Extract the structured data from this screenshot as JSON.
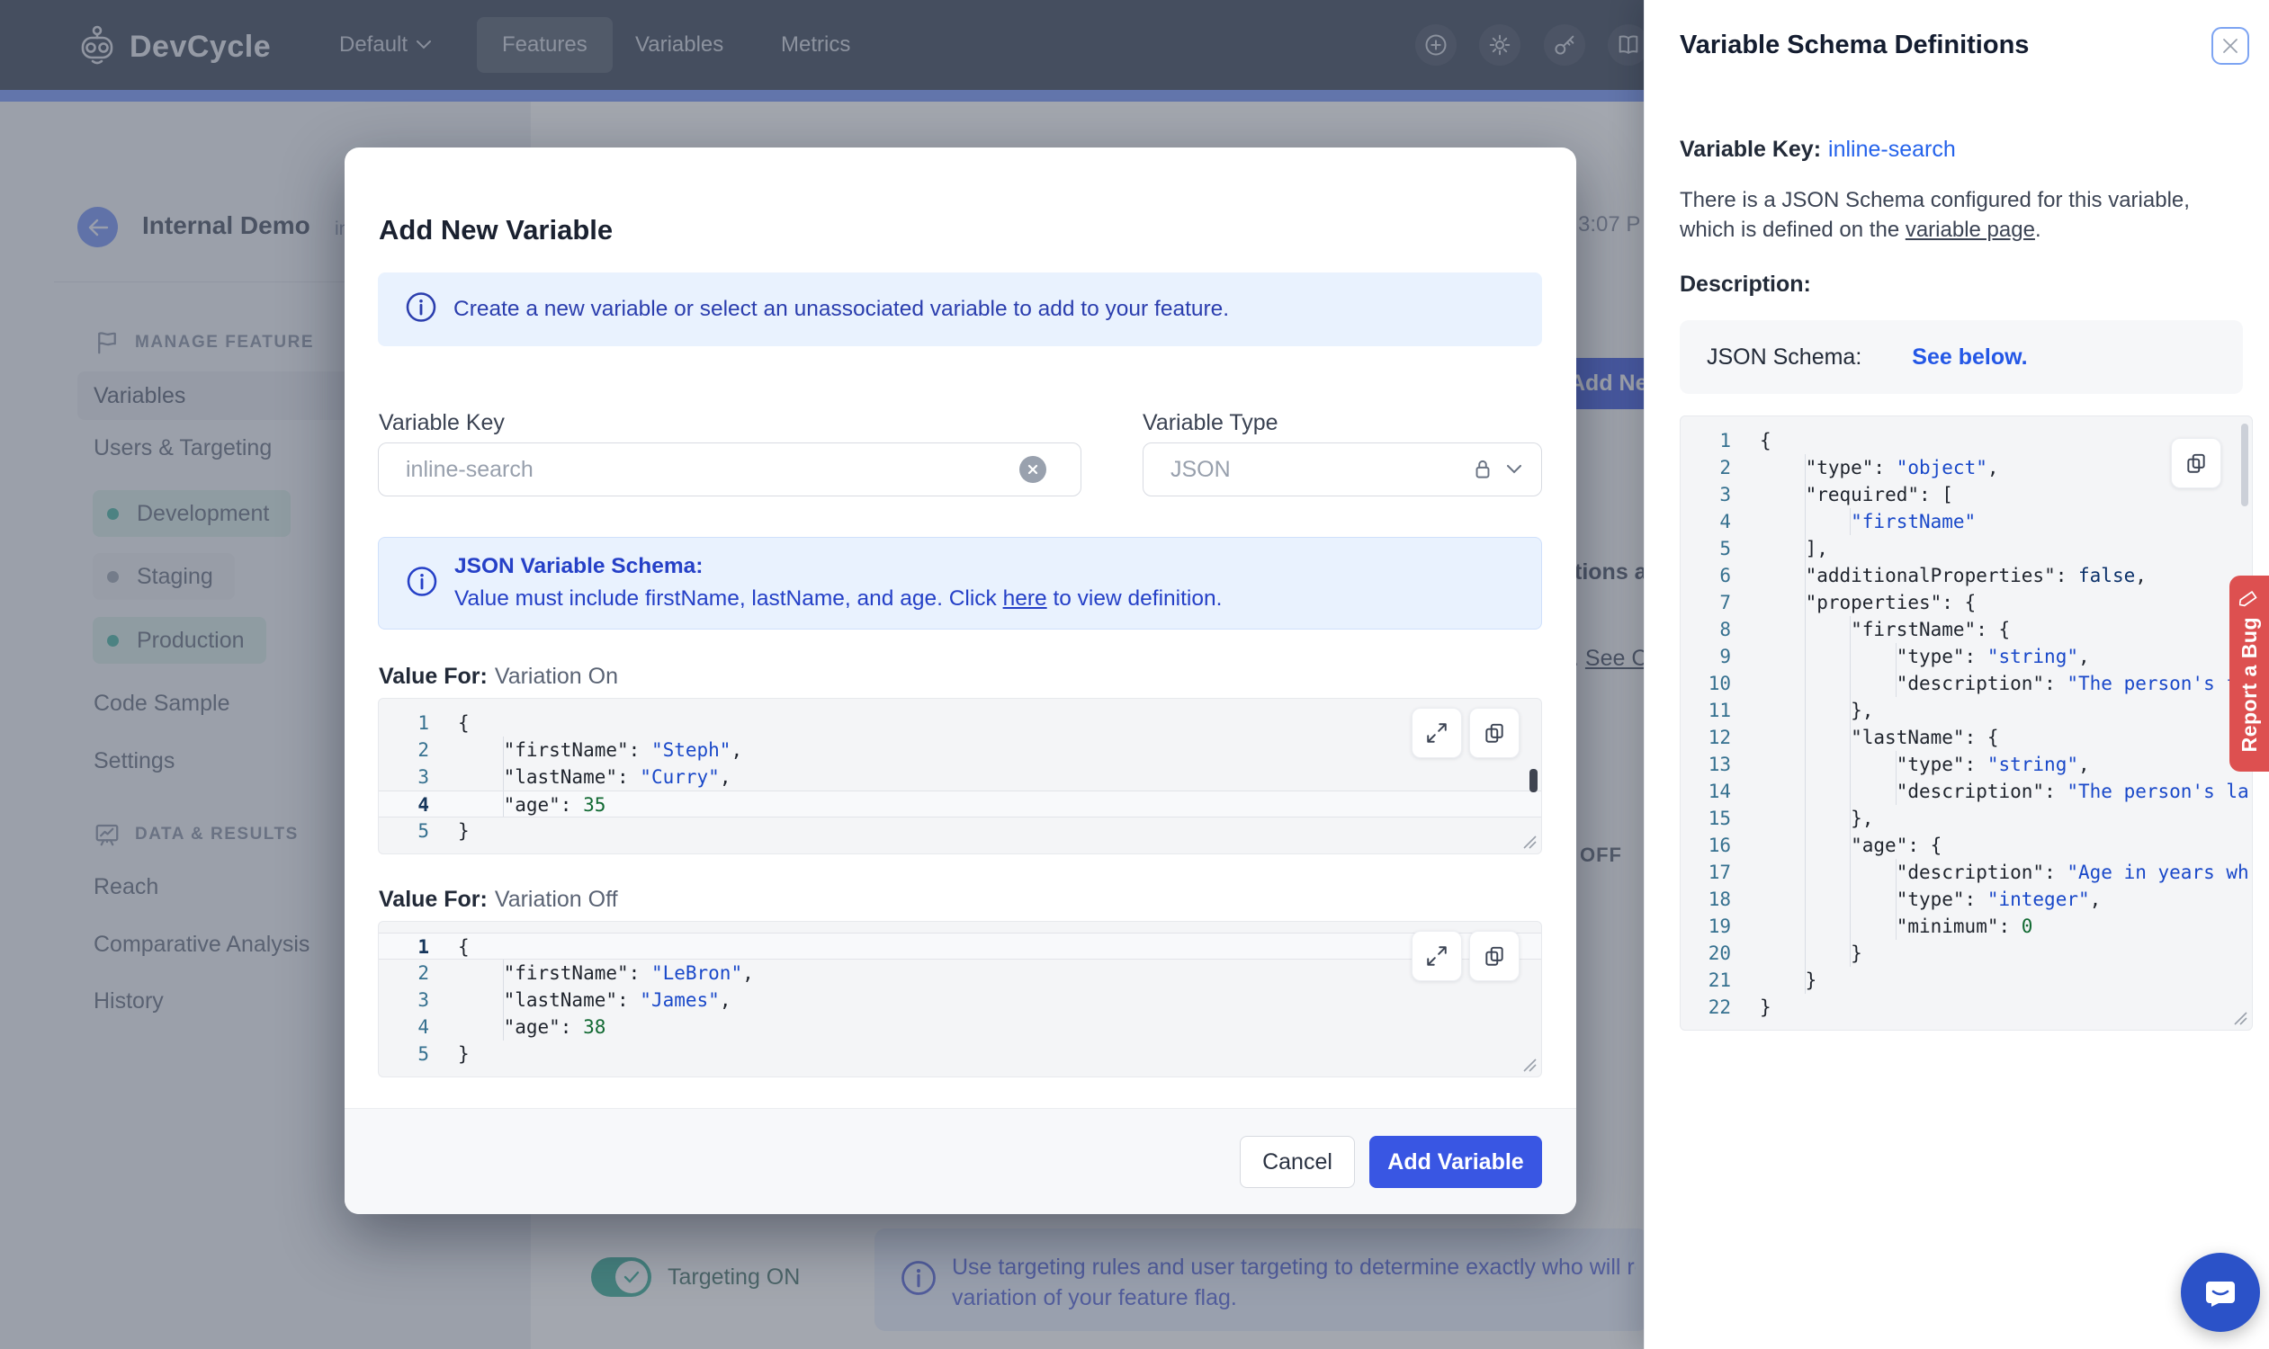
{
  "nav": {
    "brand": "DevCycle",
    "project": "Default",
    "tabs": [
      "Features",
      "Variables",
      "Metrics"
    ],
    "active_tab": "Features"
  },
  "sidebar": {
    "title": "Internal Demo",
    "title_fragment": "in",
    "sections": {
      "manage": "MANAGE FEATURE",
      "data": "DATA & RESULTS"
    },
    "manage_items": [
      {
        "label": "Variables"
      },
      {
        "label": "Users & Targeting"
      }
    ],
    "environments": [
      {
        "label": "Development",
        "tone": "teal"
      },
      {
        "label": "Staging",
        "tone": "gray"
      },
      {
        "label": "Production",
        "tone": "teal"
      }
    ],
    "manage_items2": [
      {
        "label": "Code Sample"
      },
      {
        "label": "Settings"
      }
    ],
    "data_items": [
      {
        "label": "Reach"
      },
      {
        "label": "Comparative Analysis"
      },
      {
        "label": "History"
      }
    ]
  },
  "background": {
    "time_fragment": "3:07 P",
    "add_button_fragment": "Add Ne",
    "fragment_1": "tions an",
    "fragment_2_pre": ". ",
    "fragment_2_link": "See C",
    "off_fragment": "OFF",
    "targeting_toggle_label": "Targeting ON",
    "targeting_info_line1": "Use targeting rules and user targeting to determine exactly who will receiv",
    "targeting_info_line2": "variation of your feature flag."
  },
  "modal": {
    "title": "Add New Variable",
    "info_banner": "Create a new variable or select an unassociated variable to add to your feature.",
    "variable_key": {
      "label": "Variable Key",
      "value": "inline-search"
    },
    "variable_type": {
      "label": "Variable Type",
      "value": "JSON"
    },
    "schema_banner": {
      "title": "JSON Variable Schema:",
      "body_pre": "Value must include firstName, lastName, and age. Click ",
      "link": "here",
      "body_post": " to view definition."
    },
    "value_for_label": "Value For:",
    "variation_on": "Variation On",
    "variation_off": "Variation Off",
    "cancel_label": "Cancel",
    "submit_label": "Add Variable"
  },
  "editor_on": {
    "active_line": 4,
    "lines": [
      {
        "n": 1,
        "t": [
          [
            "p",
            "{"
          ]
        ]
      },
      {
        "n": 2,
        "t": [
          [
            "ind",
            1
          ],
          [
            "k",
            "\"firstName\""
          ],
          [
            "p",
            ": "
          ],
          [
            "s",
            "\"Steph\""
          ],
          [
            "p",
            ","
          ]
        ]
      },
      {
        "n": 3,
        "t": [
          [
            "ind",
            1
          ],
          [
            "k",
            "\"lastName\""
          ],
          [
            "p",
            ": "
          ],
          [
            "s",
            "\"Curry\""
          ],
          [
            "p",
            ","
          ]
        ]
      },
      {
        "n": 4,
        "t": [
          [
            "ind",
            1
          ],
          [
            "k",
            "\"age\""
          ],
          [
            "p",
            ": "
          ],
          [
            "num",
            "35"
          ]
        ]
      },
      {
        "n": 5,
        "t": [
          [
            "p",
            "}"
          ]
        ]
      }
    ]
  },
  "editor_off": {
    "active_line": 1,
    "lines": [
      {
        "n": 1,
        "t": [
          [
            "p",
            "{"
          ]
        ]
      },
      {
        "n": 2,
        "t": [
          [
            "ind",
            1
          ],
          [
            "k",
            "\"firstName\""
          ],
          [
            "p",
            ": "
          ],
          [
            "s",
            "\"LeBron\""
          ],
          [
            "p",
            ","
          ]
        ]
      },
      {
        "n": 3,
        "t": [
          [
            "ind",
            1
          ],
          [
            "k",
            "\"lastName\""
          ],
          [
            "p",
            ": "
          ],
          [
            "s",
            "\"James\""
          ],
          [
            "p",
            ","
          ]
        ]
      },
      {
        "n": 4,
        "t": [
          [
            "ind",
            1
          ],
          [
            "k",
            "\"age\""
          ],
          [
            "p",
            ": "
          ],
          [
            "num",
            "38"
          ]
        ]
      },
      {
        "n": 5,
        "t": [
          [
            "p",
            "}"
          ]
        ]
      }
    ]
  },
  "panel": {
    "title": "Variable Schema Definitions",
    "variable_key_label": "Variable Key:",
    "variable_key_value": "inline-search",
    "body_pre": "There is a JSON Schema configured for this variable, which is defined on the ",
    "body_link": "variable page",
    "body_post": ".",
    "description_label": "Description:",
    "schema_label": "JSON Schema:",
    "schema_link": "See below."
  },
  "schema_code": {
    "active_line": 0,
    "lines": [
      {
        "n": 1,
        "t": [
          [
            "p",
            "{"
          ]
        ]
      },
      {
        "n": 2,
        "t": [
          [
            "ind",
            1
          ],
          [
            "k",
            "\"type\""
          ],
          [
            "p",
            ": "
          ],
          [
            "s",
            "\"object\""
          ],
          [
            "p",
            ","
          ]
        ]
      },
      {
        "n": 3,
        "t": [
          [
            "ind",
            1
          ],
          [
            "k",
            "\"required\""
          ],
          [
            "p",
            ": ["
          ]
        ]
      },
      {
        "n": 4,
        "t": [
          [
            "ind",
            2
          ],
          [
            "s",
            "\"firstName\""
          ]
        ]
      },
      {
        "n": 5,
        "t": [
          [
            "ind",
            1
          ],
          [
            "p",
            "],"
          ]
        ]
      },
      {
        "n": 6,
        "t": [
          [
            "ind",
            1
          ],
          [
            "k",
            "\"additionalProperties\""
          ],
          [
            "p",
            ": "
          ],
          [
            "b",
            "false"
          ],
          [
            "p",
            ","
          ]
        ]
      },
      {
        "n": 7,
        "t": [
          [
            "ind",
            1
          ],
          [
            "k",
            "\"properties\""
          ],
          [
            "p",
            ": {"
          ]
        ]
      },
      {
        "n": 8,
        "t": [
          [
            "ind",
            2
          ],
          [
            "k",
            "\"firstName\""
          ],
          [
            "p",
            ": {"
          ]
        ]
      },
      {
        "n": 9,
        "t": [
          [
            "ind",
            3
          ],
          [
            "k",
            "\"type\""
          ],
          [
            "p",
            ": "
          ],
          [
            "s",
            "\"string\""
          ],
          [
            "p",
            ","
          ]
        ]
      },
      {
        "n": 10,
        "t": [
          [
            "ind",
            3
          ],
          [
            "k",
            "\"description\""
          ],
          [
            "p",
            ": "
          ],
          [
            "s",
            "\"The person's fi"
          ]
        ]
      },
      {
        "n": 11,
        "t": [
          [
            "ind",
            2
          ],
          [
            "p",
            "},"
          ]
        ]
      },
      {
        "n": 12,
        "t": [
          [
            "ind",
            2
          ],
          [
            "k",
            "\"lastName\""
          ],
          [
            "p",
            ": {"
          ]
        ]
      },
      {
        "n": 13,
        "t": [
          [
            "ind",
            3
          ],
          [
            "k",
            "\"type\""
          ],
          [
            "p",
            ": "
          ],
          [
            "s",
            "\"string\""
          ],
          [
            "p",
            ","
          ]
        ]
      },
      {
        "n": 14,
        "t": [
          [
            "ind",
            3
          ],
          [
            "k",
            "\"description\""
          ],
          [
            "p",
            ": "
          ],
          [
            "s",
            "\"The person's la"
          ]
        ]
      },
      {
        "n": 15,
        "t": [
          [
            "ind",
            2
          ],
          [
            "p",
            "},"
          ]
        ]
      },
      {
        "n": 16,
        "t": [
          [
            "ind",
            2
          ],
          [
            "k",
            "\"age\""
          ],
          [
            "p",
            ": {"
          ]
        ]
      },
      {
        "n": 17,
        "t": [
          [
            "ind",
            3
          ],
          [
            "k",
            "\"description\""
          ],
          [
            "p",
            ": "
          ],
          [
            "s",
            "\"Age in years wh"
          ]
        ]
      },
      {
        "n": 18,
        "t": [
          [
            "ind",
            3
          ],
          [
            "k",
            "\"type\""
          ],
          [
            "p",
            ": "
          ],
          [
            "s",
            "\"integer\""
          ],
          [
            "p",
            ","
          ]
        ]
      },
      {
        "n": 19,
        "t": [
          [
            "ind",
            3
          ],
          [
            "k",
            "\"minimum\""
          ],
          [
            "p",
            ": "
          ],
          [
            "num",
            "0"
          ]
        ]
      },
      {
        "n": 20,
        "t": [
          [
            "ind",
            2
          ],
          [
            "p",
            "}"
          ]
        ]
      },
      {
        "n": 21,
        "t": [
          [
            "ind",
            1
          ],
          [
            "p",
            "}"
          ]
        ]
      },
      {
        "n": 22,
        "t": [
          [
            "p",
            "}"
          ]
        ]
      }
    ]
  },
  "report_bug_label": "Report a Bug",
  "colors": {
    "accent_blue": "#3956e3",
    "link_blue": "#2563eb",
    "banner_text": "#2b3eae",
    "code_string": "#1948c9",
    "code_number": "#116932",
    "report_red": "#dd5050",
    "nav_bg": "#303b4f",
    "env_teal": "#3fae9c"
  }
}
